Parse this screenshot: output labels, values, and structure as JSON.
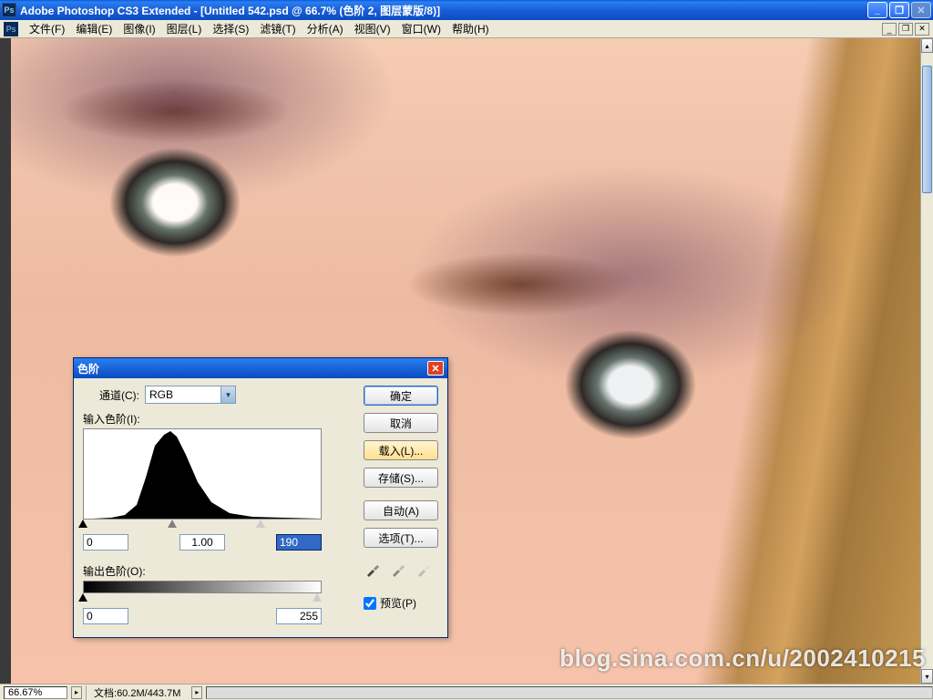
{
  "title_bar": {
    "app_icon": "Ps",
    "title": "Adobe Photoshop CS3 Extended - [Untitled 542.psd @ 66.7% (色阶 2, 图层蒙版/8)]"
  },
  "menu": {
    "items": [
      "文件(F)",
      "编辑(E)",
      "图像(I)",
      "图层(L)",
      "选择(S)",
      "滤镜(T)",
      "分析(A)",
      "视图(V)",
      "窗口(W)",
      "帮助(H)"
    ]
  },
  "status": {
    "zoom": "66.67%",
    "doc_label": "文档:",
    "doc_size": "60.2M/443.7M"
  },
  "dialog": {
    "title": "色阶",
    "channel_label": "通道(C):",
    "channel_value": "RGB",
    "input_label": "输入色阶(I):",
    "input_black": "0",
    "input_gamma": "1.00",
    "input_white": "190",
    "output_label": "输出色阶(O):",
    "output_black": "0",
    "output_white": "255",
    "buttons": {
      "ok": "确定",
      "cancel": "取消",
      "load": "载入(L)...",
      "save": "存储(S)...",
      "auto": "自动(A)",
      "options": "选项(T)..."
    },
    "preview_label": "预览(P)",
    "preview_checked": true
  },
  "watermark": "blog.sina.com.cn/u/2002410215"
}
